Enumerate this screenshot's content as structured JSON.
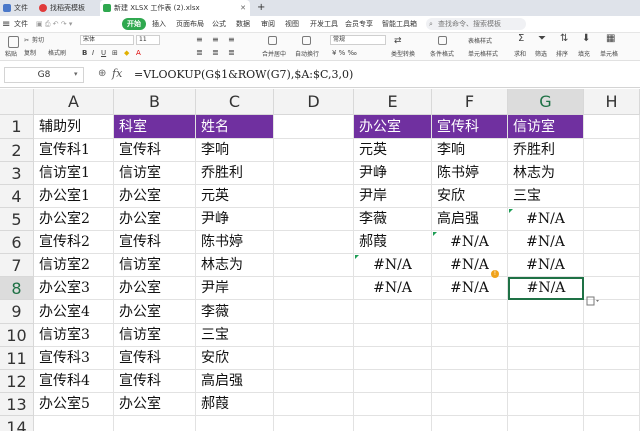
{
  "tabs": [
    {
      "label": "文件",
      "icon": "menu-icon"
    },
    {
      "label": "找稻壳模板",
      "icon": "template-icon"
    },
    {
      "label": "新建 XLSX 工作表 (2).xlsx",
      "icon": "spreadsheet-icon"
    }
  ],
  "menus": [
    "开始",
    "插入",
    "页面布局",
    "公式",
    "数据",
    "审阅",
    "视图",
    "开发工具",
    "会员专享",
    "智能工具箱"
  ],
  "search_placeholder": "查找命令、搜索模板",
  "ribbon": {
    "paste": "粘贴",
    "cut": "剪切",
    "copy": "复制",
    "format_painter": "格式刷",
    "font_name": "宋体",
    "font_size": "11",
    "merge_center": "合并居中",
    "wrap_text": "自动换行",
    "number_format": "常规",
    "type_convert": "类型转换",
    "cond_format": "条件格式",
    "table_style": "表格样式",
    "cell_style": "单元格样式",
    "sum": "求和",
    "filter": "筛选",
    "sort": "排序",
    "fill": "填充",
    "cell": "单元格"
  },
  "namebox": "G8",
  "formula": "=VLOOKUP(G$1&ROW(G7),$A:$C,3,0)",
  "columns": [
    "A",
    "B",
    "C",
    "D",
    "E",
    "F",
    "G",
    "H"
  ],
  "rows": [
    "1",
    "2",
    "3",
    "4",
    "5",
    "6",
    "7",
    "8",
    "9",
    "10",
    "11",
    "12",
    "13",
    "14"
  ],
  "cells": {
    "A": [
      "辅助列",
      "宣传科1",
      "信访室1",
      "办公室1",
      "办公室2",
      "宣传科2",
      "信访室2",
      "办公室3",
      "办公室4",
      "信访室3",
      "宣传科3",
      "宣传科4",
      "办公室5",
      ""
    ],
    "B": [
      "科室",
      "宣传科",
      "信访室",
      "办公室",
      "办公室",
      "宣传科",
      "信访室",
      "办公室",
      "办公室",
      "信访室",
      "宣传科",
      "宣传科",
      "办公室",
      ""
    ],
    "C": [
      "姓名",
      "李响",
      "乔胜利",
      "元英",
      "尹峥",
      "陈书婷",
      "林志为",
      "尹岸",
      "李薇",
      "三宝",
      "安欣",
      "高启强",
      "郝葭",
      ""
    ],
    "E": [
      "办公室",
      "元英",
      "尹峥",
      "尹岸",
      "李薇",
      "郝葭",
      "#N/A",
      "#N/A",
      "",
      "",
      "",
      "",
      "",
      ""
    ],
    "F": [
      "宣传科",
      "李响",
      "陈书婷",
      "安欣",
      "高启强",
      "#N/A",
      "#N/A",
      "#N/A",
      "",
      "",
      "",
      "",
      "",
      ""
    ],
    "G": [
      "信访室",
      "乔胜利",
      "林志为",
      "三宝",
      "#N/A",
      "#N/A",
      "#N/A",
      "#N/A",
      "",
      "",
      "",
      "",
      "",
      ""
    ]
  },
  "colors": {
    "header_fill": "#7030a0",
    "header_text": "#ffffff",
    "selection": "#1e7145",
    "start_tab": "#2fa84f"
  }
}
